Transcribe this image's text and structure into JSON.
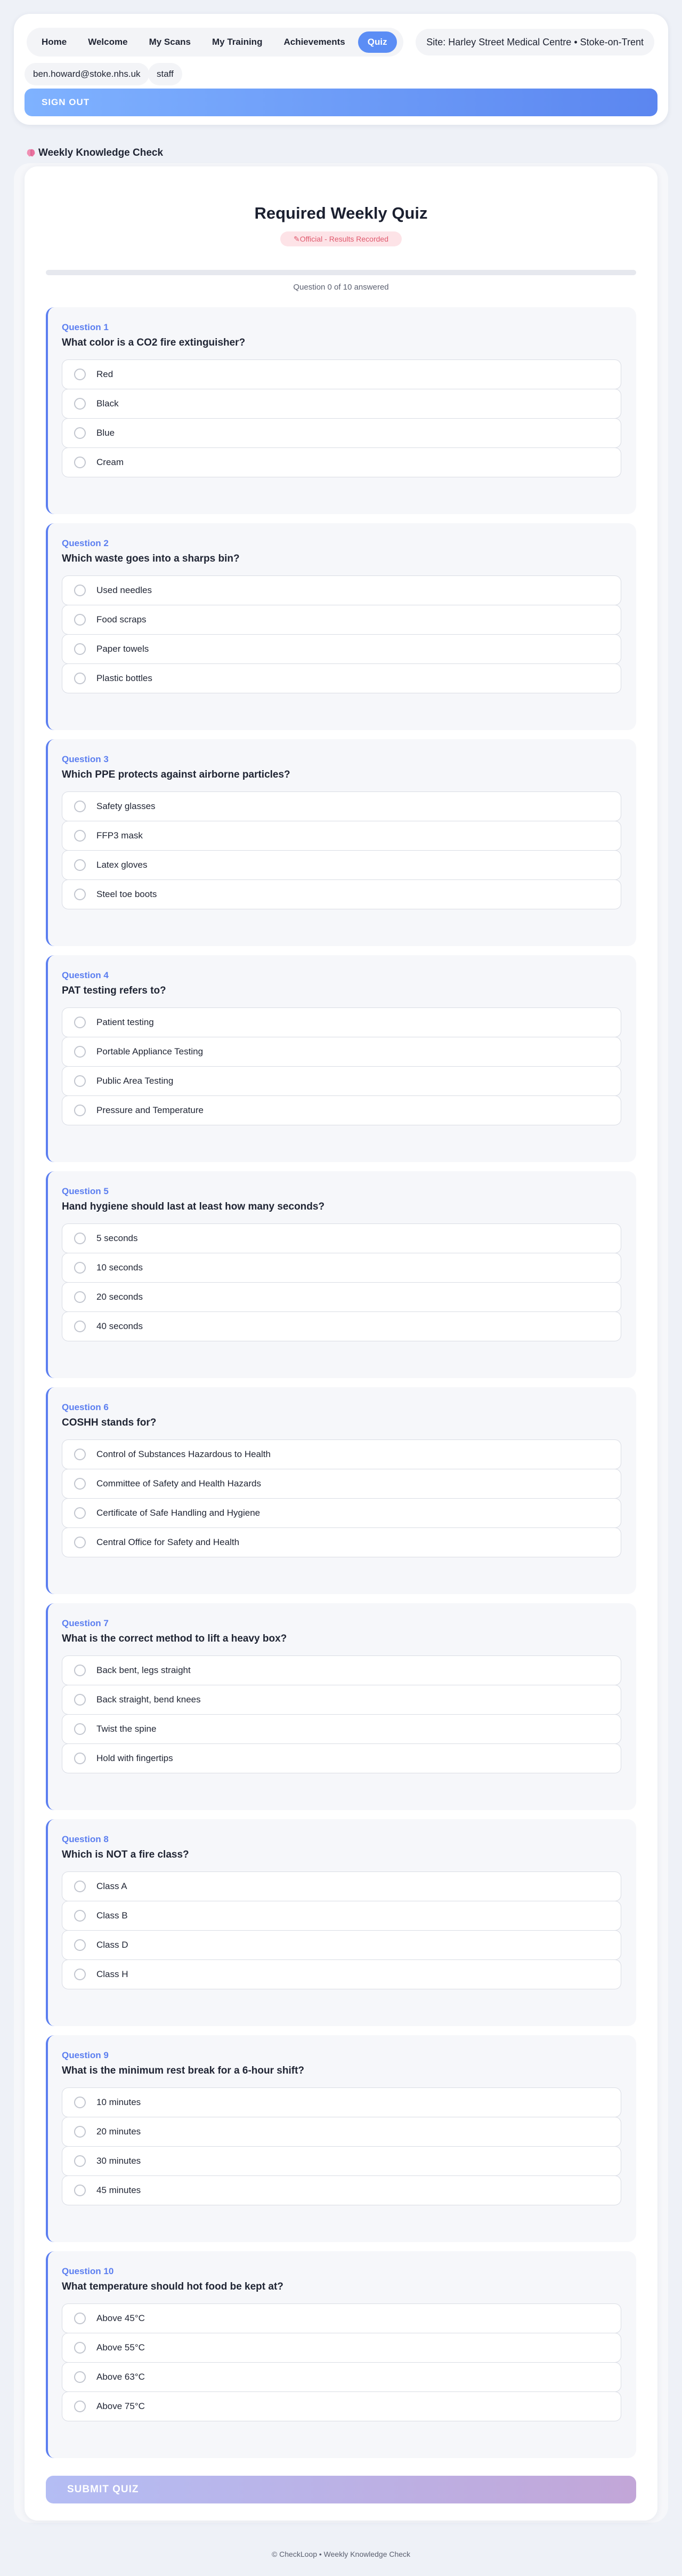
{
  "nav": {
    "items": [
      {
        "label": "Home",
        "active": false
      },
      {
        "label": "Welcome",
        "active": false
      },
      {
        "label": "My Scans",
        "active": false
      },
      {
        "label": "My Training",
        "active": false
      },
      {
        "label": "Achievements",
        "active": false
      },
      {
        "label": "Quiz",
        "active": true
      }
    ],
    "site": "Site: Harley Street Medical Centre • Stoke-on-Trent",
    "user_email": "ben.howard@stoke.nhs.uk",
    "user_role": "staff",
    "signout_label": "SIGN OUT"
  },
  "section_title": "Weekly Knowledge Check",
  "quiz": {
    "title": "Required Weekly Quiz",
    "badge": "Official - Results Recorded",
    "progress_text": "Question 0 of 10 answered",
    "progress_fraction": 0,
    "questions": [
      {
        "number": "Question 1",
        "text": "What color is a CO2 fire extinguisher?",
        "options": [
          "Red",
          "Black",
          "Blue",
          "Cream"
        ]
      },
      {
        "number": "Question 2",
        "text": "Which waste goes into a sharps bin?",
        "options": [
          "Used needles",
          "Food scraps",
          "Paper towels",
          "Plastic bottles"
        ]
      },
      {
        "number": "Question 3",
        "text": "Which PPE protects against airborne particles?",
        "options": [
          "Safety glasses",
          "FFP3 mask",
          "Latex gloves",
          "Steel toe boots"
        ]
      },
      {
        "number": "Question 4",
        "text": "PAT testing refers to?",
        "options": [
          "Patient testing",
          "Portable Appliance Testing",
          "Public Area Testing",
          "Pressure and Temperature"
        ]
      },
      {
        "number": "Question 5",
        "text": "Hand hygiene should last at least how many seconds?",
        "options": [
          "5 seconds",
          "10 seconds",
          "20 seconds",
          "40 seconds"
        ]
      },
      {
        "number": "Question 6",
        "text": "COSHH stands for?",
        "options": [
          "Control of Substances Hazardous to Health",
          "Committee of Safety and Health Hazards",
          "Certificate of Safe Handling and Hygiene",
          "Central Office for Safety and Health"
        ]
      },
      {
        "number": "Question 7",
        "text": "What is the correct method to lift a heavy box?",
        "options": [
          "Back bent, legs straight",
          "Back straight, bend knees",
          "Twist the spine",
          "Hold with fingertips"
        ]
      },
      {
        "number": "Question 8",
        "text": "Which is NOT a fire class?",
        "options": [
          "Class A",
          "Class B",
          "Class D",
          "Class H"
        ]
      },
      {
        "number": "Question 9",
        "text": "What is the minimum rest break for a 6-hour shift?",
        "options": [
          "10 minutes",
          "20 minutes",
          "30 minutes",
          "45 minutes"
        ]
      },
      {
        "number": "Question 10",
        "text": "What temperature should hot food be kept at?",
        "options": [
          "Above 45°C",
          "Above 55°C",
          "Above 63°C",
          "Above 75°C"
        ]
      }
    ],
    "submit_label": "SUBMIT QUIZ"
  },
  "footer": "© CheckLoop • Weekly Knowledge Check",
  "colors": {
    "accent": "#5b8df5",
    "question_accent": "#5b7ef0",
    "badge_bg": "#fde3e7",
    "badge_text": "#e05a6e"
  }
}
